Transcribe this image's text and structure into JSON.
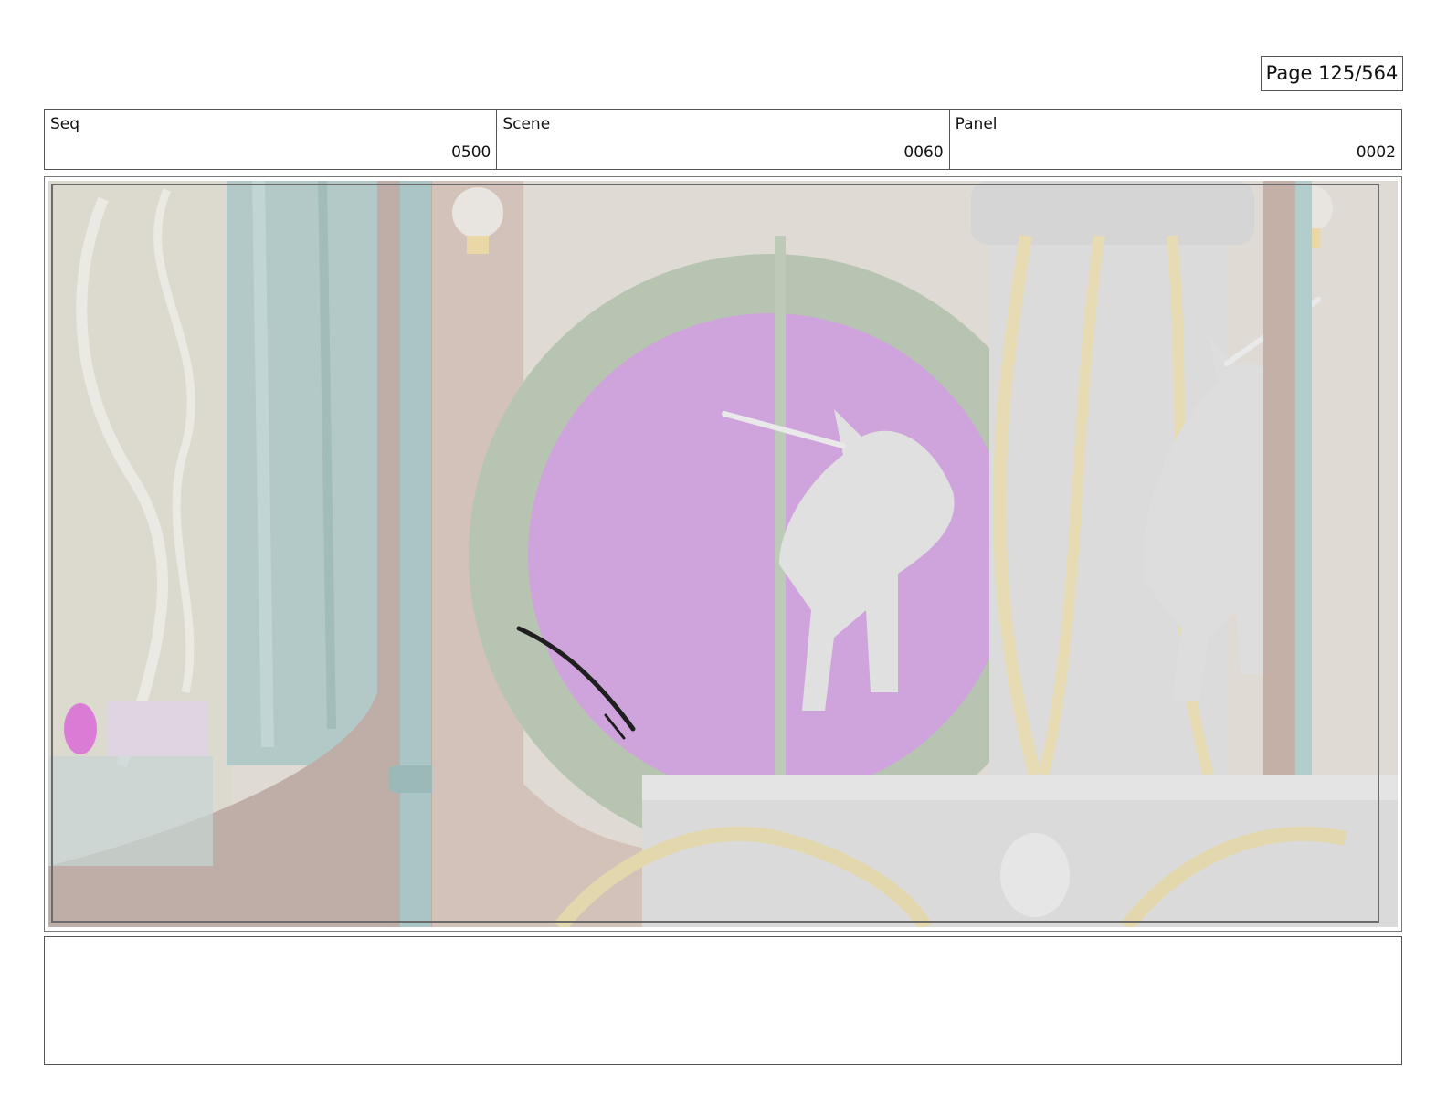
{
  "page": {
    "label": "Page 125/564"
  },
  "header": {
    "seq": {
      "title": "Seq",
      "value": "0500"
    },
    "scene": {
      "title": "Scene",
      "value": "0060"
    },
    "panel": {
      "title": "Panel",
      "value": "0002"
    }
  },
  "panel_image": {
    "icon": "storyboard-frame",
    "colors": {
      "wall": "#d6d2c9",
      "teal": "#9fbcbc",
      "mauve": "#b7a49c",
      "window_magenta": "#c897d9",
      "ring_green": "#aab9a4",
      "statue_gray": "#d7d7d7",
      "gold": "#e1d4a3"
    }
  },
  "notes": {
    "text": ""
  }
}
